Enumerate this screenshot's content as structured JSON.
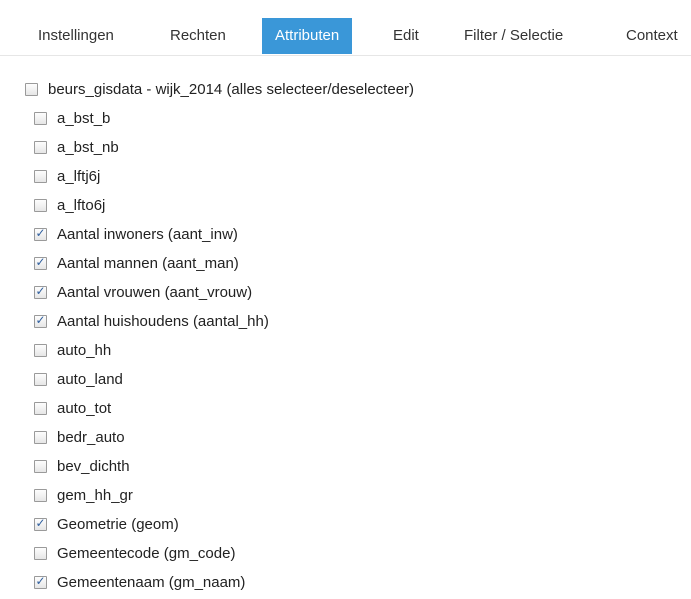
{
  "tabs": [
    {
      "label": "Instellingen",
      "active": false
    },
    {
      "label": "Rechten",
      "active": false
    },
    {
      "label": "Attributen",
      "active": true
    },
    {
      "label": "Edit",
      "active": false
    },
    {
      "label": "Filter / Selectie",
      "active": false
    },
    {
      "label": "Context",
      "active": false
    }
  ],
  "colors": {
    "active_tab_bg": "#3a97d8",
    "checkmark": "#2f5f9e"
  },
  "attributes": {
    "select_all": {
      "label": "beurs_gisdata - wijk_2014 (alles selecteer/deselecteer)",
      "checked": false
    },
    "items": [
      {
        "label": "a_bst_b",
        "checked": false
      },
      {
        "label": "a_bst_nb",
        "checked": false
      },
      {
        "label": "a_lftj6j",
        "checked": false
      },
      {
        "label": "a_lfto6j",
        "checked": false
      },
      {
        "label": "Aantal inwoners (aant_inw)",
        "checked": true
      },
      {
        "label": "Aantal mannen (aant_man)",
        "checked": true
      },
      {
        "label": "Aantal vrouwen (aant_vrouw)",
        "checked": true
      },
      {
        "label": "Aantal huishoudens (aantal_hh)",
        "checked": true
      },
      {
        "label": "auto_hh",
        "checked": false
      },
      {
        "label": "auto_land",
        "checked": false
      },
      {
        "label": "auto_tot",
        "checked": false
      },
      {
        "label": "bedr_auto",
        "checked": false
      },
      {
        "label": "bev_dichth",
        "checked": false
      },
      {
        "label": "gem_hh_gr",
        "checked": false
      },
      {
        "label": "Geometrie (geom)",
        "checked": true
      },
      {
        "label": "Gemeentecode (gm_code)",
        "checked": false
      },
      {
        "label": "Gemeentenaam (gm_naam)",
        "checked": true
      }
    ]
  }
}
